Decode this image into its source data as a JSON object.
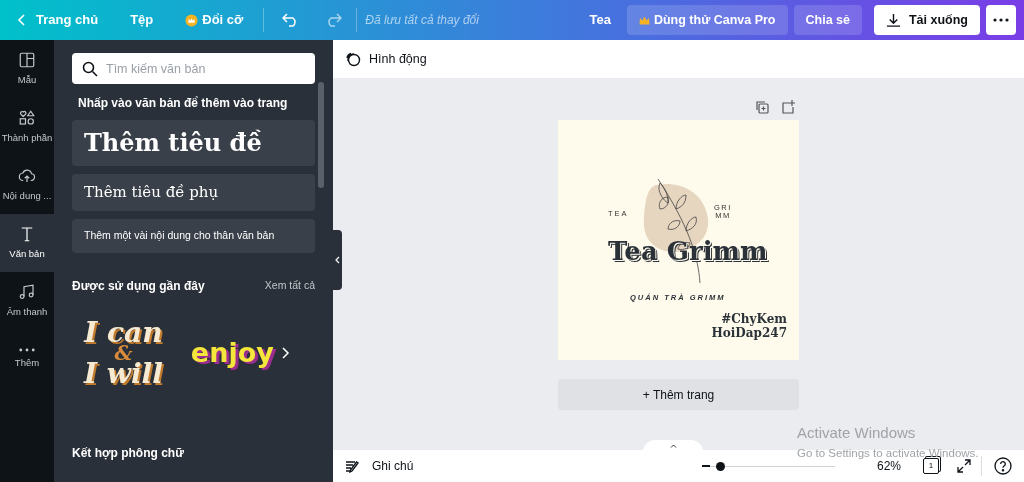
{
  "top_bar": {
    "back": "Trang chủ",
    "file": "Tệp",
    "resize": "Đổi cỡ",
    "saved_status": "Đã lưu tất cả thay đổi",
    "design_title": "Tea",
    "pro_button": "Dùng thử Canva Pro",
    "share_button": "Chia sẻ",
    "download_button": "Tải xuống"
  },
  "rail": [
    {
      "kind": "templates",
      "label": "Mẫu",
      "selected": false
    },
    {
      "kind": "elements",
      "label": "Thành phần",
      "selected": false
    },
    {
      "kind": "uploads",
      "label": "Nội dung ...",
      "selected": false
    },
    {
      "kind": "text",
      "label": "Văn bản",
      "selected": true
    },
    {
      "kind": "audio",
      "label": "Âm thanh",
      "selected": false
    },
    {
      "kind": "more",
      "label": "Thêm",
      "selected": false
    }
  ],
  "panel": {
    "search": {
      "placeholder": "Tìm kiếm văn bản"
    },
    "hint": "Nhấp vào văn bản để thêm vào trang",
    "text_presets": [
      {
        "kind": "heading",
        "label": "Thêm tiêu đề"
      },
      {
        "kind": "subheading",
        "label": "Thêm tiêu đề phụ"
      },
      {
        "kind": "body",
        "label": "Thêm một vài nội dung cho thân văn bản"
      }
    ],
    "recent_title": "Được sử dụng gần đây",
    "see_all": "Xem tất cả",
    "recent": [
      {
        "kind": "stacked",
        "lines": [
          "I can",
          "&",
          "I will"
        ]
      },
      {
        "kind": "single",
        "lines": [
          "enjoy"
        ]
      }
    ],
    "font_combos_title": "Kết hợp phông chữ"
  },
  "toolbar": {
    "animate": "Hình động"
  },
  "design": {
    "small_left": "TEA",
    "small_right": [
      "GRI",
      "MM"
    ],
    "title": "Tea Grimm",
    "subtitle": "QUÁN TRÀ GRIMM",
    "tags": [
      "#ChyKem",
      "HoiDap247"
    ]
  },
  "add_page": "+ Thêm trang",
  "bottom_bar": {
    "notes": "Ghi chú",
    "zoom": {
      "level": 0.08
    },
    "zoom_reading": "62%",
    "page_count": "1"
  },
  "os_notice": {
    "title": "Activate Windows",
    "subtitle": "Go to Settings to activate Windows."
  }
}
